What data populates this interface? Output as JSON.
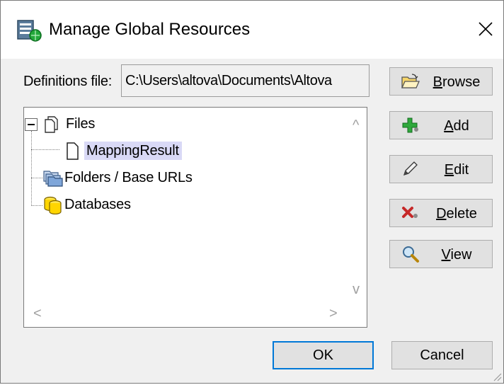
{
  "window": {
    "title": "Manage Global Resources",
    "title_icon": "global-resources-icon",
    "close_icon": "close-icon"
  },
  "definitions": {
    "label": "Definitions file:",
    "value": "C:\\Users\\altova\\Documents\\Altova"
  },
  "tree": {
    "nodes": [
      {
        "label": "Files",
        "icon": "files-icon",
        "expanded": true
      },
      {
        "label": "MappingResult",
        "icon": "file-icon",
        "selected": true
      },
      {
        "label": "Folders / Base URLs",
        "icon": "folders-icon"
      },
      {
        "label": "Databases",
        "icon": "databases-icon"
      }
    ],
    "scroll_up": "^",
    "scroll_down": "v",
    "scroll_left": "<",
    "scroll_right": ">"
  },
  "buttons": {
    "browse": {
      "label_first": "B",
      "label_rest": "rowse",
      "icon": "folder-open-icon"
    },
    "add": {
      "label_first": "A",
      "label_rest": "dd",
      "icon": "plus-icon"
    },
    "edit": {
      "label_first": "E",
      "label_rest": "dit",
      "icon": "pencil-icon"
    },
    "delete": {
      "label_first": "D",
      "label_rest": "elete",
      "icon": "delete-x-icon"
    },
    "view": {
      "label_first": "V",
      "label_rest": "iew",
      "icon": "magnifier-icon"
    },
    "ok": "OK",
    "cancel": "Cancel"
  },
  "colors": {
    "selection": "#d9d9f6",
    "default_button_border": "#0078d7",
    "dialog_background": "#f0f0f0"
  }
}
